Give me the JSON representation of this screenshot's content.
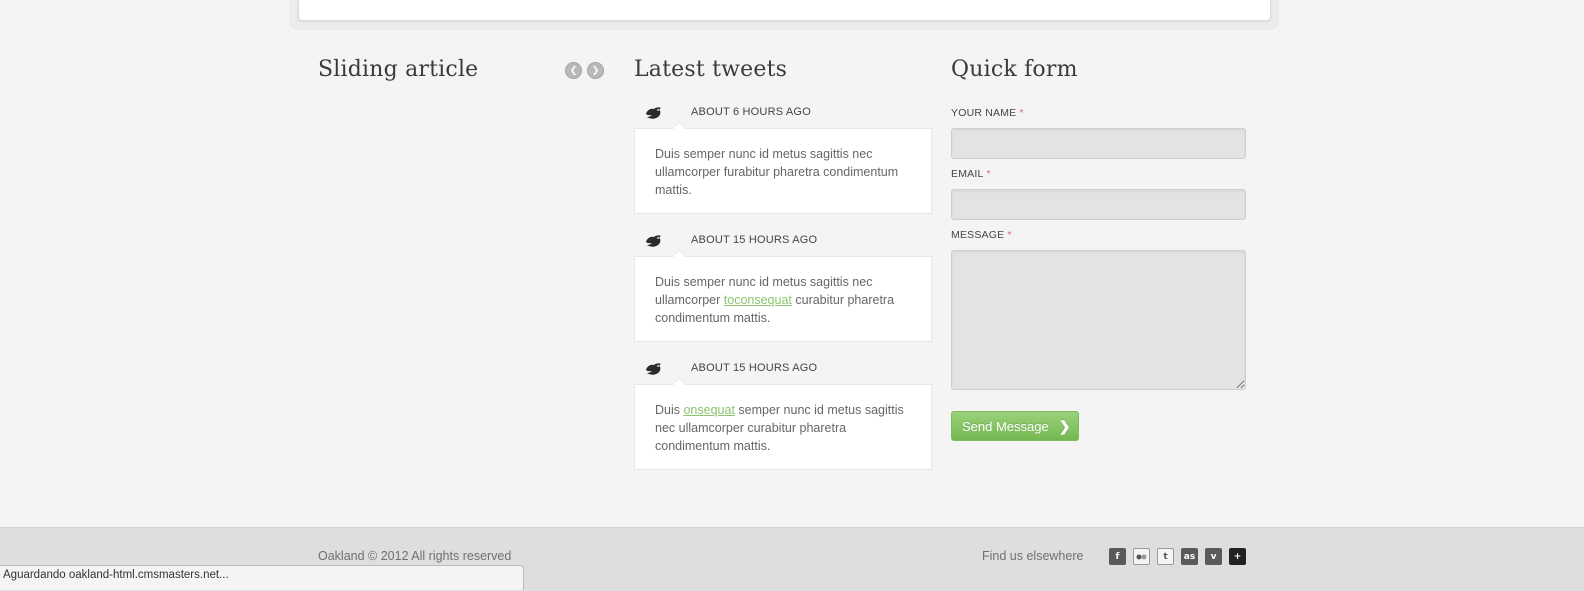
{
  "sliding_article": {
    "title": "Sliding article",
    "prev_icon": "chevron-left",
    "next_icon": "chevron-right"
  },
  "tweets": {
    "title": "Latest tweets",
    "items": [
      {
        "time": "ABOUT 6 HOURS AGO",
        "text_before": "Duis semper nunc id metus sagittis nec ullamcorper furabitur pharetra condimentum mattis.",
        "link": "",
        "text_after": ""
      },
      {
        "time": "ABOUT 15 HOURS AGO",
        "text_before": "Duis semper nunc id metus sagittis nec ullamcorper ",
        "link": "toconsequat",
        "text_after": " curabitur pharetra condimentum mattis."
      },
      {
        "time": "ABOUT 15 HOURS AGO",
        "text_before": "Duis ",
        "link": "onsequat",
        "text_after": " semper nunc id metus sagittis nec ullamcorper curabitur pharetra condimentum mattis."
      }
    ]
  },
  "quick_form": {
    "title": "Quick form",
    "required_mark": "*",
    "name_label": "YOUR NAME",
    "name_value": "",
    "email_label": "EMAIL",
    "email_value": "",
    "message_label": "MESSAGE",
    "message_value": "",
    "send_label": "Send Message",
    "send_icon": "chevron-right"
  },
  "footer": {
    "copyright": "Oakland © 2012 All rights reserved",
    "find_us": "Find us elsewhere",
    "social_icons": [
      "facebook-icon",
      "flickr-icon",
      "twitter-icon",
      "lastfm-icon",
      "vimeo-icon",
      "googleplus-icon"
    ]
  },
  "status_bar": {
    "text": "Aguardando oakland-html.cmsmasters.net..."
  },
  "colors": {
    "page_bg": "#f4f4f4",
    "accent_green": "#8bc56e",
    "button_green": "#74b852",
    "footer_bg": "#dedede",
    "required_red": "#d96b6b"
  }
}
